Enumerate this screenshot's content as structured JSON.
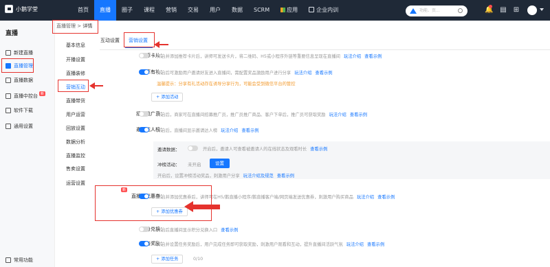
{
  "app": {
    "name": "小鹅学堂"
  },
  "topnav": {
    "items": [
      "首页",
      "直播",
      "圈子",
      "课程",
      "营销",
      "交易",
      "用户",
      "数据",
      "SCRM",
      "应用",
      "企业内训"
    ],
    "active": "直播"
  },
  "search": {
    "placeholder": "功能、页...",
    "mark_icon": "triangle-logo-icon",
    "search_icon": "magnifier-icon"
  },
  "sidebar": {
    "title": "直播",
    "items": [
      {
        "label": "新建直播",
        "icon": "plus-doc-icon"
      },
      {
        "label": "直播管理",
        "icon": "live-icon",
        "active": true
      },
      {
        "label": "直播数据",
        "icon": "chart-icon"
      },
      {
        "label": "直播中控台",
        "icon": "monitor-icon",
        "badge": "新"
      },
      {
        "label": "软件下载",
        "icon": "download-icon"
      },
      {
        "label": "通用设置",
        "icon": "gear-icon"
      }
    ],
    "footer": "常用功能"
  },
  "breadcrumb": {
    "parent": "直播管理",
    "separator": " > ",
    "current": "详情"
  },
  "subnav": [
    "基本信息",
    "开播设置",
    "直播装修",
    "营销互动",
    "直播带货",
    "用户运营",
    "回放设置",
    "数据分析",
    "直播监控",
    "售卖设置",
    "运营设置"
  ],
  "tabs": [
    "互动设置",
    "营销设置"
  ],
  "settings": {
    "recommend": {
      "label": "推荐卡片：",
      "desc": "开启并添加推荐卡片后，讲师可发送卡片，将二维码、H5或小程序外链等重要信息呈现在直播间",
      "link1": "玩法介绍",
      "link2": "查看示例",
      "on": false
    },
    "share": {
      "label": "分享有礼：",
      "desc": "开启后可激励用户邀请好友进入直播间，需配置奖品激励用户进行分享",
      "link1": "玩法介绍",
      "link2": "查看示例",
      "on": true,
      "warn": "温馨提示：分享有礼活动存在诱导分享行为，可能会受到微信平台的管控",
      "add": "+ 添加活动"
    },
    "promoter": {
      "label": "招募推广员：",
      "desc": "开启后，商家可在直播间招募推广员，推广员推广商品、客户下单后，推广员可获取奖励",
      "link1": "玩法介绍",
      "link2": "查看示例",
      "on": false
    },
    "invite": {
      "label": "邀请达人榜：",
      "desc": "开启后，直播间显示邀请达人榜",
      "link1": "玩法介绍",
      "link2": "查看示例",
      "on": true,
      "box": {
        "data_label": "邀请数据：",
        "data_desc": "开启后，邀请人可查看被邀请人的在线状态及观看时长",
        "data_link": "查看示例",
        "rush_label": "冲榜活动：",
        "rush_status": "未开启",
        "rush_btn": "设置",
        "rush_desc": "开启后，设置冲榜活动奖品，刺激用户分享",
        "rush_link1": "玩法介绍及规范",
        "rush_link2": "查看示例"
      }
    },
    "coupon": {
      "label": "直播间优惠券：",
      "badge": "新",
      "desc": "开启并添加优惠券后，讲师可在H5/鹅直播小程序/鹅直播客户端/网页端发送优惠券，刺激用户购买商品",
      "link1": "玩法介绍",
      "link2": "查看示例",
      "on": true,
      "add": "+ 添加优惠券"
    },
    "points": {
      "label": "积分兑换：",
      "desc": "开启后直播间显示积分兑换入口",
      "link1": "查看示例",
      "on": false
    },
    "task": {
      "label": "任务奖励：",
      "desc": "开启并设置任务奖励后，用户完成任务即可获取奖励，刺激用户观看和互动，提升直播间活跃气氛",
      "link1": "玩法介绍",
      "link2": "查看示例",
      "on": true,
      "add": "+ 添加任务",
      "count": "0/10"
    }
  }
}
